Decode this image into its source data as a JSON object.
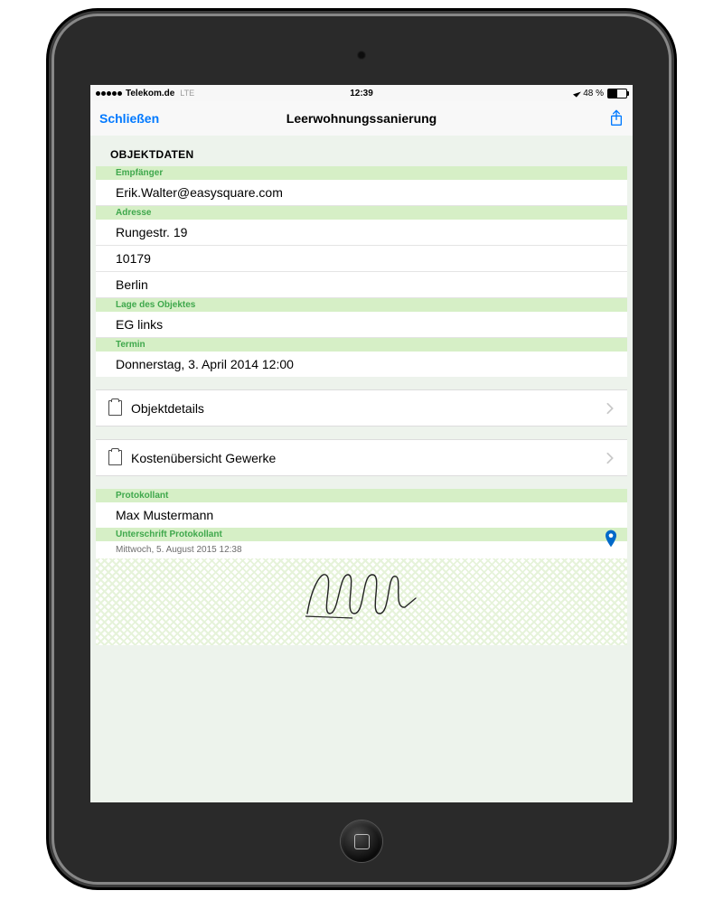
{
  "status": {
    "carrier": "Telekom.de",
    "network": "LTE",
    "time": "12:39",
    "battery_text": "48 %"
  },
  "nav": {
    "close": "Schließen",
    "title": "Leerwohnungssanierung"
  },
  "section_header": "OBJEKTDATEN",
  "labels": {
    "empfaenger": "Empfänger",
    "adresse": "Adresse",
    "lage": "Lage des Objektes",
    "termin": "Termin",
    "protokollant": "Protokollant",
    "unterschrift": "Unterschrift Protokollant"
  },
  "values": {
    "empfaenger": "Erik.Walter@easysquare.com",
    "adresse_strasse": "Rungestr. 19",
    "adresse_plz": "10179",
    "adresse_stadt": "Berlin",
    "lage": "EG links",
    "termin": "Donnerstag, 3. April 2014 12:00",
    "protokollant": "Max Mustermann",
    "unterschrift_zeit": "Mittwoch, 5. August 2015 12:38"
  },
  "links": {
    "objektdetails": "Objektdetails",
    "kosten": "Kostenübersicht Gewerke"
  }
}
